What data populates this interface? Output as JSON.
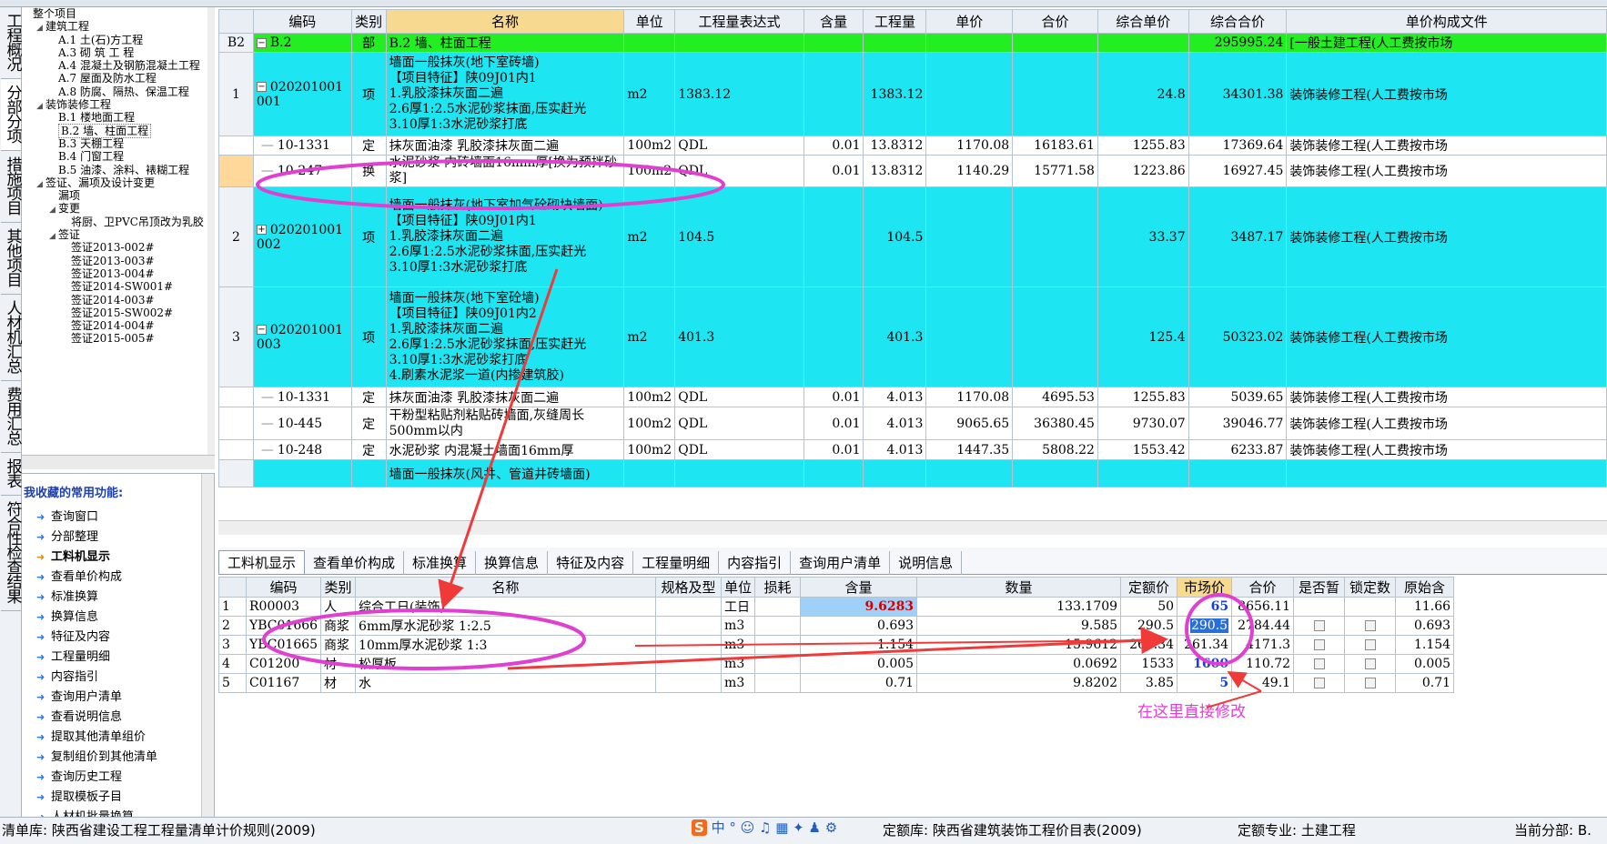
{
  "vtabs": [
    "工程概况",
    "分部分项",
    "措施项目",
    "其他项目",
    "人材机汇总",
    "费用汇总",
    "报表",
    "符合性检查结果"
  ],
  "active_vtab": 1,
  "tree": [
    {
      "d": 0,
      "t": "整个项目",
      "tog": ""
    },
    {
      "d": 1,
      "t": "建筑工程",
      "tog": "◢"
    },
    {
      "d": 2,
      "t": "A.1  土(石)方工程",
      "tog": ""
    },
    {
      "d": 2,
      "t": "A.3  砌 筑 工 程",
      "tog": ""
    },
    {
      "d": 2,
      "t": "A.4  混凝土及钢筋混凝土工程",
      "tog": ""
    },
    {
      "d": 2,
      "t": "A.7  屋面及防水工程",
      "tog": ""
    },
    {
      "d": 2,
      "t": "A.8  防腐、隔热、保温工程",
      "tog": ""
    },
    {
      "d": 1,
      "t": "装饰装修工程",
      "tog": "◢"
    },
    {
      "d": 2,
      "t": "B.1  楼地面工程",
      "tog": ""
    },
    {
      "d": 2,
      "t": "B.2  墙、柱面工程",
      "tog": "",
      "sel": true
    },
    {
      "d": 2,
      "t": "B.3  天棚工程",
      "tog": ""
    },
    {
      "d": 2,
      "t": "B.4  门窗工程",
      "tog": ""
    },
    {
      "d": 2,
      "t": "B.5  油漆、涂料、裱糊工程",
      "tog": ""
    },
    {
      "d": 1,
      "t": "签证、漏项及设计变更",
      "tog": "◢"
    },
    {
      "d": 2,
      "t": "漏项",
      "tog": ""
    },
    {
      "d": 2,
      "t": "变更",
      "tog": "◢"
    },
    {
      "d": 3,
      "t": "将厨、卫PVC吊顶改为乳胶",
      "tog": ""
    },
    {
      "d": 2,
      "t": "签证",
      "tog": "◢"
    },
    {
      "d": 3,
      "t": "签证2013-002#",
      "tog": ""
    },
    {
      "d": 3,
      "t": "签证2013-003#",
      "tog": ""
    },
    {
      "d": 3,
      "t": "签证2013-004#",
      "tog": ""
    },
    {
      "d": 3,
      "t": "签证2014-SW001#",
      "tog": ""
    },
    {
      "d": 3,
      "t": "签证2014-003#",
      "tog": ""
    },
    {
      "d": 3,
      "t": "签证2015-SW002#",
      "tog": ""
    },
    {
      "d": 3,
      "t": "签证2014-004#",
      "tog": ""
    },
    {
      "d": 3,
      "t": "签证2015-005#",
      "tog": ""
    }
  ],
  "fav": {
    "title": "我收藏的常用功能:",
    "items": [
      "查询窗口",
      "分部整理",
      "工料机显示",
      "查看单价构成",
      "标准换算",
      "换算信息",
      "特征及内容",
      "工程量明细",
      "内容指引",
      "查询用户清单",
      "查看说明信息",
      "提取其他清单组价",
      "复制组价到其他清单",
      "查询历史工程",
      "提取模板子目",
      "人材机批量换算"
    ],
    "highlight": 2
  },
  "grid": {
    "headers": [
      "",
      "编码",
      "类别",
      "名称",
      "单位",
      "工程量表达式",
      "含量",
      "工程量",
      "单价",
      "合价",
      "综合单价",
      "综合合价",
      "单价构成文件"
    ],
    "rows": [
      {
        "style": "green",
        "h": 20,
        "cells": [
          "B2",
          "B.2",
          "部",
          "B.2  墙、柱面工程",
          "",
          "",
          "",
          "",
          "",
          "",
          "",
          "295995.24",
          "[一般土建工程(人工费按市场"
        ],
        "tog": "−"
      },
      {
        "style": "cyan",
        "h": 92,
        "cells": [
          "1",
          "020201001001",
          "项",
          "墙面一般抹灰(地下室砖墙)\n【项目特征】陕09J01内1\n1.乳胶漆抹灰面二遍\n2.6厚1:2.5水泥砂浆抹面,压实赶光\n3.10厚1:3水泥砂浆打底",
          "m2",
          "1383.12",
          "",
          "1383.12",
          "",
          "",
          "24.8",
          "34301.38",
          "装饰装修工程(人工费按市场"
        ],
        "tog": "−"
      },
      {
        "style": "white",
        "h": 19,
        "cells": [
          "",
          "10-1331",
          "定",
          "抹灰面油漆 乳胶漆抹灰面二遍",
          "100m2",
          "QDL",
          "0.01",
          "13.8312",
          "1170.08",
          "16183.61",
          "1255.83",
          "17369.64",
          "装饰装修工程(人工费按市场"
        ]
      },
      {
        "style": "cur",
        "h": 34,
        "cells": [
          "",
          "10-247",
          "换",
          "水泥砂浆 内砖墙面16mm厚[换为预拌砂浆]",
          "100m2",
          "QDL",
          "0.01",
          "13.8312",
          "1140.29",
          "15771.58",
          "1223.86",
          "16927.45",
          "装饰装修工程(人工费按市场"
        ]
      },
      {
        "style": "cyan",
        "h": 110,
        "cells": [
          "2",
          "020201001002",
          "项",
          "墙面一般抹灰(地下室加气砼砌块墙面)\n【项目特征】陕09J01内1\n1.乳胶漆抹灰面二遍\n2.6厚1:2.5水泥砂浆抹面,压实赶光\n3.10厚1:3水泥砂浆打底",
          "m2",
          "104.5",
          "",
          "104.5",
          "",
          "",
          "33.37",
          "3487.17",
          "装饰装修工程(人工费按市场"
        ],
        "tog": "+"
      },
      {
        "style": "cyan",
        "h": 110,
        "cells": [
          "3",
          "020201001003",
          "项",
          "墙面一般抹灰(地下室砼墙)\n【项目特征】陕09J01内2\n1.乳胶漆抹灰面二遍\n2.6厚1:2.5水泥砂浆抹面,压实赶光\n3.10厚1:3水泥砂浆打底\n4.刷素水泥浆一道(内掺建筑胶)",
          "m2",
          "401.3",
          "",
          "401.3",
          "",
          "",
          "125.4",
          "50323.02",
          "装饰装修工程(人工费按市场"
        ],
        "tog": "−"
      },
      {
        "style": "white",
        "h": 22,
        "cells": [
          "",
          "10-1331",
          "定",
          "抹灰面油漆 乳胶漆抹灰面二遍",
          "100m2",
          "QDL",
          "0.01",
          "4.013",
          "1170.08",
          "4695.53",
          "1255.83",
          "5039.65",
          "装饰装修工程(人工费按市场"
        ]
      },
      {
        "style": "white",
        "h": 36,
        "cells": [
          "",
          "10-445",
          "定",
          "干粉型粘贴剂粘贴砖墙面,灰缝周长500mm以内",
          "100m2",
          "QDL",
          "0.01",
          "4.013",
          "9065.65",
          "36380.45",
          "9730.07",
          "39046.77",
          "装饰装修工程(人工费按市场"
        ]
      },
      {
        "style": "white",
        "h": 22,
        "cells": [
          "",
          "10-248",
          "定",
          "水泥砂浆 内混凝土墙面16mm厚",
          "100m2",
          "QDL",
          "0.01",
          "4.013",
          "1447.35",
          "5808.22",
          "1553.42",
          "6233.87",
          "装饰装修工程(人工费按市场"
        ]
      },
      {
        "style": "cyan",
        "h": 30,
        "cells": [
          "",
          "",
          "",
          "墙面一般抹灰(风井、管道井砖墙面)",
          "",
          "",
          "",
          "",
          "",
          "",
          "",
          "",
          ""
        ]
      }
    ]
  },
  "tabs": [
    "工料机显示",
    "查看单价构成",
    "标准换算",
    "换算信息",
    "特征及内容",
    "工程量明细",
    "内容指引",
    "查询用户清单",
    "说明信息"
  ],
  "sub": {
    "headers": [
      "",
      "编码",
      "类别",
      "名称",
      "规格及型",
      "单位",
      "损耗",
      "含量",
      "数量",
      "定额价",
      "市场价",
      "合价",
      "是否暂",
      "锁定数",
      "原始含"
    ],
    "rows": [
      [
        "1",
        "R00003",
        "人",
        "综合工日(装饰)",
        "",
        "工日",
        "",
        "9.6283",
        "133.1709",
        "50",
        "65",
        "8656.11",
        "",
        "",
        "11.66"
      ],
      [
        "2",
        "YBC01666",
        "商浆",
        "6mm厚水泥砂浆 1:2.5",
        "",
        "m3",
        "",
        "0.693",
        "9.585",
        "290.5",
        "290.5",
        "2784.44",
        "cb",
        "cb",
        "0.693"
      ],
      [
        "3",
        "YBC01665",
        "商浆",
        "10mm厚水泥砂浆 1:3",
        "",
        "m3",
        "",
        "1.154",
        "15.9612",
        "261.34",
        "261.34",
        "4171.3",
        "cb",
        "cb",
        "1.154"
      ],
      [
        "4",
        "C01200",
        "材",
        "松厚板",
        "",
        "m3",
        "",
        "0.005",
        "0.0692",
        "1533",
        "1600",
        "110.72",
        "cb",
        "cb",
        "0.005"
      ],
      [
        "5",
        "C01167",
        "材",
        "水",
        "",
        "m3",
        "",
        "0.71",
        "9.8202",
        "3.85",
        "5",
        "49.1",
        "cb",
        "cb",
        "0.71"
      ]
    ]
  },
  "annotation": "在这里直接修改",
  "status": {
    "left": "清单库: 陕西省建设工程工程量清单计价规则(2009)",
    "quota": "定额库: 陕西省建筑装饰工程价目表(2009)",
    "major": "定额专业: 土建工程",
    "current": "当前分部: B."
  },
  "colors": {
    "green": "#22ee22",
    "cyan": "#1de6f2",
    "annot": "#e03fd2",
    "arrow": "#f03a3a"
  }
}
